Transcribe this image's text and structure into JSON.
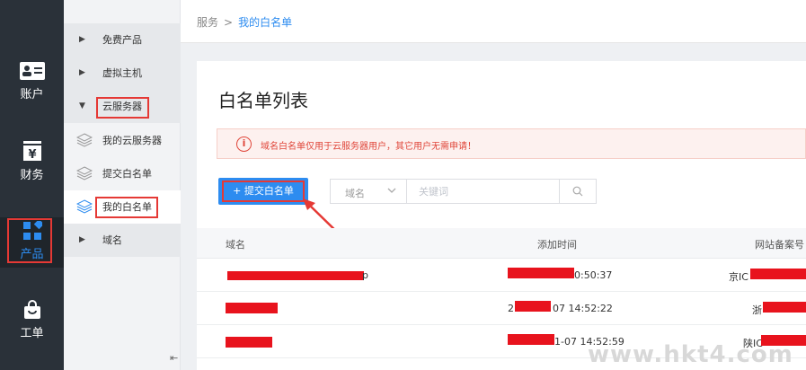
{
  "rail": {
    "items": [
      {
        "label": "账户",
        "icon": "account-card-icon"
      },
      {
        "label": "财务",
        "icon": "finance-yen-icon"
      },
      {
        "label": "产品",
        "icon": "product-grid-icon"
      },
      {
        "label": "工单",
        "icon": "ticket-bag-icon"
      }
    ]
  },
  "menu": {
    "items": [
      {
        "label": "免费产品"
      },
      {
        "label": "虚拟主机"
      },
      {
        "label": "云服务器"
      },
      {
        "label": "我的云服务器"
      },
      {
        "label": "提交白名单"
      },
      {
        "label": "我的白名单"
      },
      {
        "label": "域名"
      }
    ]
  },
  "breadcrumb": {
    "root": "服务",
    "sep": ">",
    "current": "我的白名单"
  },
  "page": {
    "title": "白名单列表",
    "notice": "域名白名单仅用于云服务器用户，其它用户无需申请！",
    "add_button": "+ 提交白名单"
  },
  "search": {
    "select_value": "域名",
    "placeholder": "关键词"
  },
  "table": {
    "headers": [
      "域名",
      "添加时间",
      "网站备案号"
    ],
    "rows": [
      {
        "domain_tail": "p",
        "time_tail": "0:50:37",
        "icp_head": "京IC"
      },
      {
        "domain_tail": "",
        "time_head": "2",
        "time_tail": "07 14:52:22",
        "icp_head": "浙"
      },
      {
        "domain_tail": "",
        "time_tail": "1-07 14:52:59",
        "icp_head": "陕IC"
      }
    ]
  },
  "watermark": "www.hkt4.com",
  "colors": {
    "accent": "#2d8cf0",
    "rail": "#2a3139",
    "highlight": "#e53935",
    "notice": "#e0463a"
  }
}
